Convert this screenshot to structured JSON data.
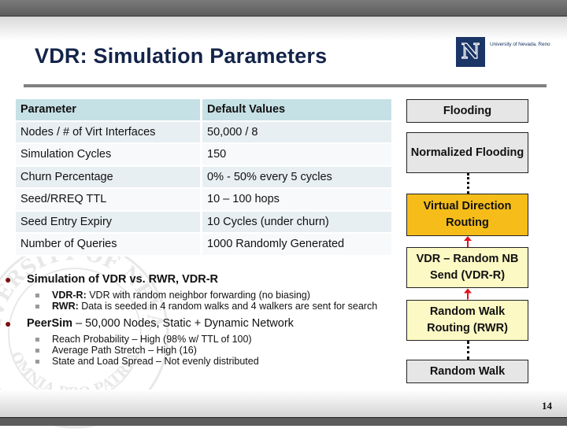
{
  "logo": {
    "letter": "N",
    "text": "University of Nevada, Reno"
  },
  "watermark": {
    "top_text": "UNIVERSITY OF NEVADA",
    "motto": "OMNIA PRO PATRIA"
  },
  "title": "VDR: Simulation Parameters",
  "table": {
    "headers": [
      "Parameter",
      "Default Values"
    ],
    "rows": [
      [
        "Nodes / # of Virt Interfaces",
        "50,000 / 8"
      ],
      [
        "Simulation Cycles",
        "150"
      ],
      [
        "Churn Percentage",
        "0% - 50% every 5 cycles"
      ],
      [
        "Seed/RREQ TTL",
        "10 – 100 hops"
      ],
      [
        "Seed Entry Expiry",
        "10 Cycles (under churn)"
      ],
      [
        "Number of Queries",
        "1000 Randomly Generated"
      ]
    ]
  },
  "bullets": [
    {
      "text_bold": "Simulation of VDR vs. RWR, VDR-R",
      "text_rest": "",
      "sub": [
        {
          "bold": "VDR-R:",
          "text": " VDR with random neighbor forwarding (no biasing)"
        },
        {
          "bold": "RWR:",
          "text": " Data is seeded in 4 random walks and 4 walkers are sent for search"
        }
      ]
    },
    {
      "text_bold": "PeerSim",
      "text_rest": " – 50,000 Nodes, Static + Dynamic Network",
      "sub": [
        {
          "bold": "",
          "text": "Reach Probability – High (98% w/ TTL of 100)"
        },
        {
          "bold": "",
          "text": "Average Path Stretch – High (16)"
        },
        {
          "bold": "",
          "text": "State and Load Spread – Not evenly distributed"
        }
      ]
    }
  ],
  "flow": {
    "boxes": [
      {
        "label": "Flooding",
        "style": "gray"
      },
      {
        "label": "Normalized Flooding",
        "style": "gray"
      },
      {
        "label": "Virtual Direction Routing",
        "style": "orange"
      },
      {
        "label": "VDR – Random NB Send (VDR-R)",
        "style": "yellow"
      },
      {
        "label": "Random Walk Routing (RWR)",
        "style": "yellow"
      },
      {
        "label": "Random Walk",
        "style": "gray"
      }
    ],
    "colors": {
      "gray": "#e6e6e6",
      "orange": "#f6bd1a",
      "yellow": "#fdf9c4",
      "arrow": "#e0141e"
    }
  },
  "page_number": "14"
}
